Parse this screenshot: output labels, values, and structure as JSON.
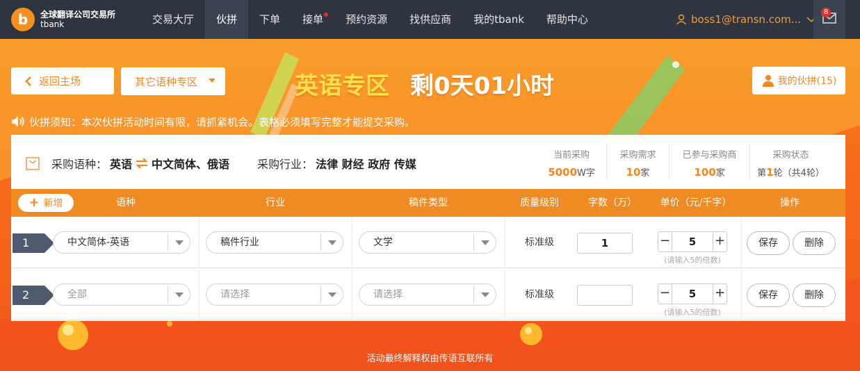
{
  "nav": {
    "logo_char": "b",
    "logo_line1": "全球翻译公司交易所",
    "logo_line2": "tbank",
    "items": [
      {
        "label": "交易大厅"
      },
      {
        "label": "伙拼"
      },
      {
        "label": "下单"
      },
      {
        "label": "接单"
      },
      {
        "label": "预约资源"
      },
      {
        "label": "找供应商"
      },
      {
        "label": "我的tbank"
      },
      {
        "label": "帮助中心"
      }
    ],
    "active_index": 1,
    "dot_index": 3,
    "user_email": "boss1@transn.com...",
    "mail_count": "8"
  },
  "hero": {
    "back_label": "返回主场",
    "other_lang_label": "其它语种专区",
    "zone_title": "英语专区",
    "remaining": "剩0天01小时",
    "partner_label": "我的伙拼(15)"
  },
  "notice": "伙拼须知：本次伙拼活动时间有限，请抓紧机会。表格必须填写完整才能提交采购。",
  "info": {
    "lang_label": "采购语种：",
    "source_lang": "英语",
    "target_langs": "中文简体、俄语",
    "industry_label": "采购行业：",
    "industries": "法律 财经 政府 传媒",
    "stats": [
      {
        "title": "当前采购",
        "prefix": "",
        "value": "5000",
        "suffix": "W字"
      },
      {
        "title": "采购需求",
        "prefix": "",
        "value": "10",
        "suffix": "家"
      },
      {
        "title": "已参与采购商",
        "prefix": "",
        "value": "100",
        "suffix": "家"
      },
      {
        "title": "采购状态",
        "prefix": "第",
        "value": "1",
        "suffix": "轮（共4轮）"
      }
    ]
  },
  "table": {
    "add_label": "新增",
    "headers": {
      "language": "语种",
      "industry": "行业",
      "doc_type": "稿件类型",
      "quality": "质量级别",
      "words": "字数（万）",
      "price": "单价（元/千字）",
      "action": "操作"
    },
    "rows": [
      {
        "index": "1",
        "language": "中文简体-英语",
        "industry": "稿件行业",
        "doc_type": "文学",
        "quality": "标准级",
        "words": "1",
        "price": "5",
        "price_hint": "(请输入5的倍数)",
        "save": "保存",
        "delete": "删除"
      },
      {
        "index": "2",
        "language": "全部",
        "industry": "请选择",
        "doc_type": "请选择",
        "quality": "标准级",
        "words": "",
        "price": "5",
        "price_hint": "(请输入5的倍数)",
        "save": "保存",
        "delete": "删除"
      }
    ]
  },
  "footer": "活动最终解释权由传语互联所有",
  "colors": {
    "accent": "#f5871f",
    "nav_bg": "#2e3440",
    "header_bar": "#f08a22",
    "row_index_bg": "#4f5a6e",
    "zone_title": "#ffe14d"
  },
  "icons": {
    "back": "chevron-left-icon",
    "dropdown": "triangle-down-icon",
    "partner": "person-icon",
    "notice": "speaker-icon",
    "cart": "bag-icon",
    "swap": "swap-arrows-icon",
    "user": "user-icon",
    "mail": "mail-icon"
  }
}
